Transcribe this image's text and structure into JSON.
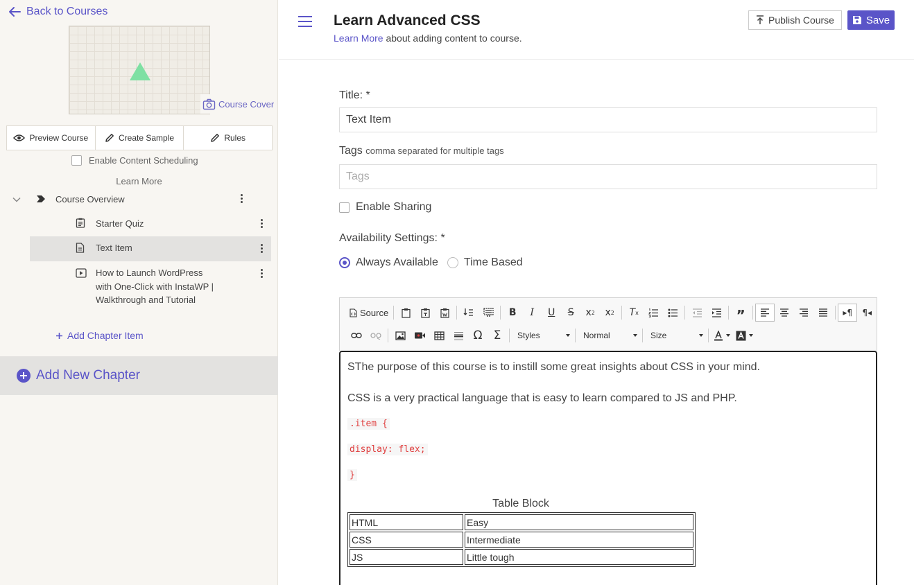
{
  "sidebar": {
    "back_label": "Back to Courses",
    "cover_button": "Course Cover",
    "actions": [
      {
        "label": "Preview Course",
        "icon": "eye-icon"
      },
      {
        "label": "Create Sample",
        "icon": "pencil-icon"
      },
      {
        "label": "Rules",
        "icon": "pencil-icon"
      }
    ],
    "scheduling_label": "Enable Content Scheduling",
    "learn_more": "Learn More",
    "chapter": {
      "title": "Course Overview",
      "items": [
        {
          "label": "Starter Quiz",
          "icon": "clipboard-icon"
        },
        {
          "label": "Text Item",
          "icon": "document-icon",
          "active": true
        },
        {
          "label": "How to Launch WordPress with One-Click with InstaWP | Walkthrough and Tutorial",
          "icon": "video-icon"
        }
      ]
    },
    "add_chapter_item": "Add Chapter Item",
    "add_new_chapter": "Add New Chapter",
    "accent": "#5a54c8"
  },
  "header": {
    "title": "Learn Advanced CSS",
    "subtitle_link": "Learn More",
    "subtitle_text": "about adding content to course.",
    "publish_label": "Publish Course",
    "save_label": "Save"
  },
  "form": {
    "title_label": "Title: *",
    "title_value": "Text Item",
    "tags_label": "Tags",
    "tags_hint": "comma separated for multiple tags",
    "tags_placeholder": "Tags",
    "sharing_label": "Enable Sharing",
    "availability_label": "Availability Settings: *",
    "availability_options": [
      "Always Available",
      "Time Based"
    ],
    "availability_selected": "Always Available"
  },
  "editor": {
    "toolbar": {
      "source_label": "Source",
      "styles_label": "Styles",
      "format_label": "Normal",
      "size_label": "Size"
    },
    "content": {
      "paragraph1": "SThe purpose of this course is to instill some great insights about CSS in your mind.",
      "paragraph2": "CSS is a very practical language that is easy to learn compared to JS and PHP.",
      "code_lines": [
        ".item {",
        "display: flex;",
        "}"
      ],
      "table_caption": "Table Block",
      "table_rows": [
        [
          "HTML",
          "Easy"
        ],
        [
          "CSS",
          "Intermediate"
        ],
        [
          "JS",
          "Little tough"
        ]
      ]
    }
  }
}
